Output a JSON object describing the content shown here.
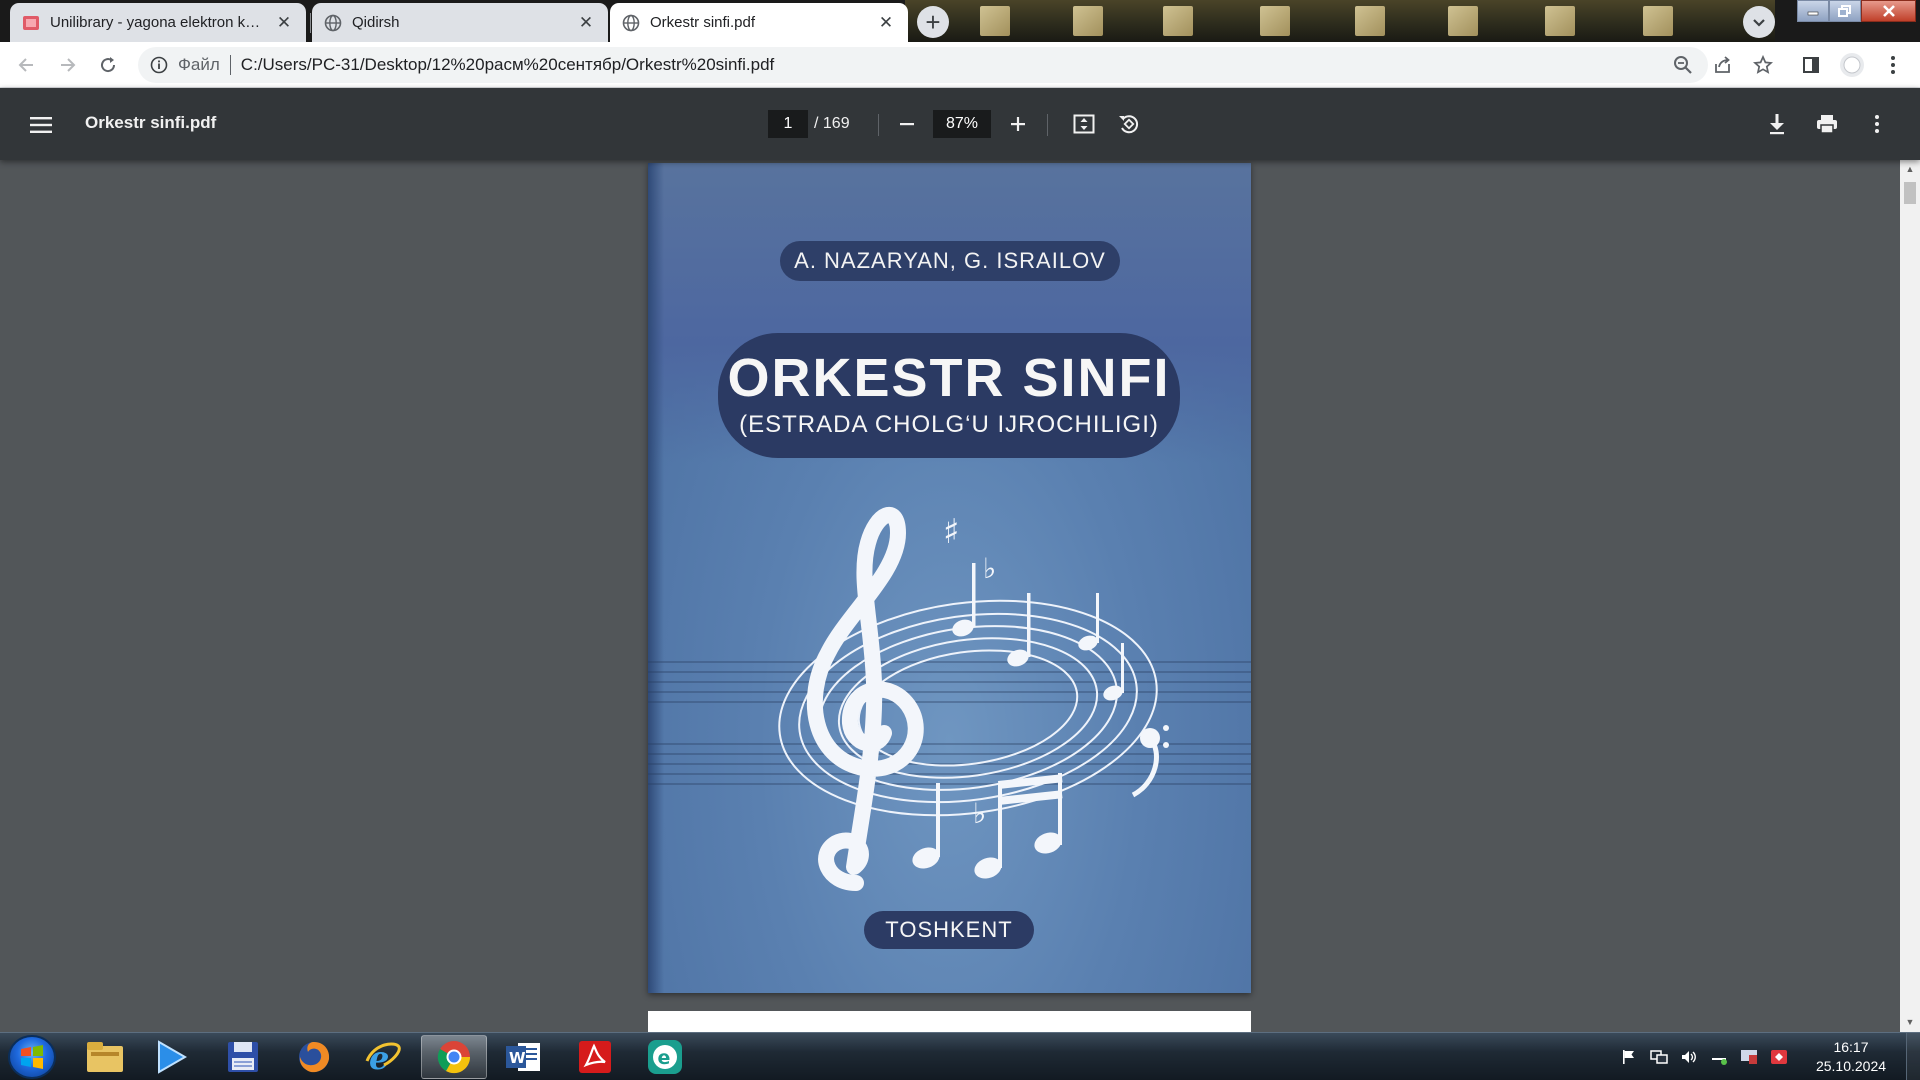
{
  "browser": {
    "tabs": [
      {
        "title": "Unilibrary - yagona elektron kutubxona",
        "favicon": "library-favicon",
        "active": false
      },
      {
        "title": "Qidirsh",
        "favicon": "globe-icon",
        "active": false
      },
      {
        "title": "Orkestr sinfi.pdf",
        "favicon": "globe-icon",
        "active": true
      }
    ],
    "omnibox": {
      "scheme_label": "Файл",
      "url": "C:/Users/PC-31/Desktop/12%20расм%20сентябр/Orkestr%20sinfi.pdf"
    }
  },
  "pdf_viewer": {
    "file_name": "Orkestr sinfi.pdf",
    "current_page": "1",
    "total_pages": "/ 169",
    "zoom": "87%"
  },
  "cover": {
    "authors": "A. NAZARYAN, G. ISRAILOV",
    "title": "ORKESTR SINFI",
    "subtitle": "(ESTRADA CHOLG‘U IJROCHILIGI)",
    "city": "TOSHKENT",
    "background_color": "#5a80b0",
    "pill_color": "#2b3a63"
  },
  "taskbar": {
    "apps": [
      "explorer-icon",
      "media-player-icon",
      "save-disk-icon",
      "firefox-icon",
      "ie-icon",
      "chrome-icon",
      "word-icon",
      "acrobat-icon",
      "edge-like-icon"
    ],
    "active_app": "chrome-icon",
    "clock_time": "16:17",
    "clock_date": "25.10.2024"
  }
}
